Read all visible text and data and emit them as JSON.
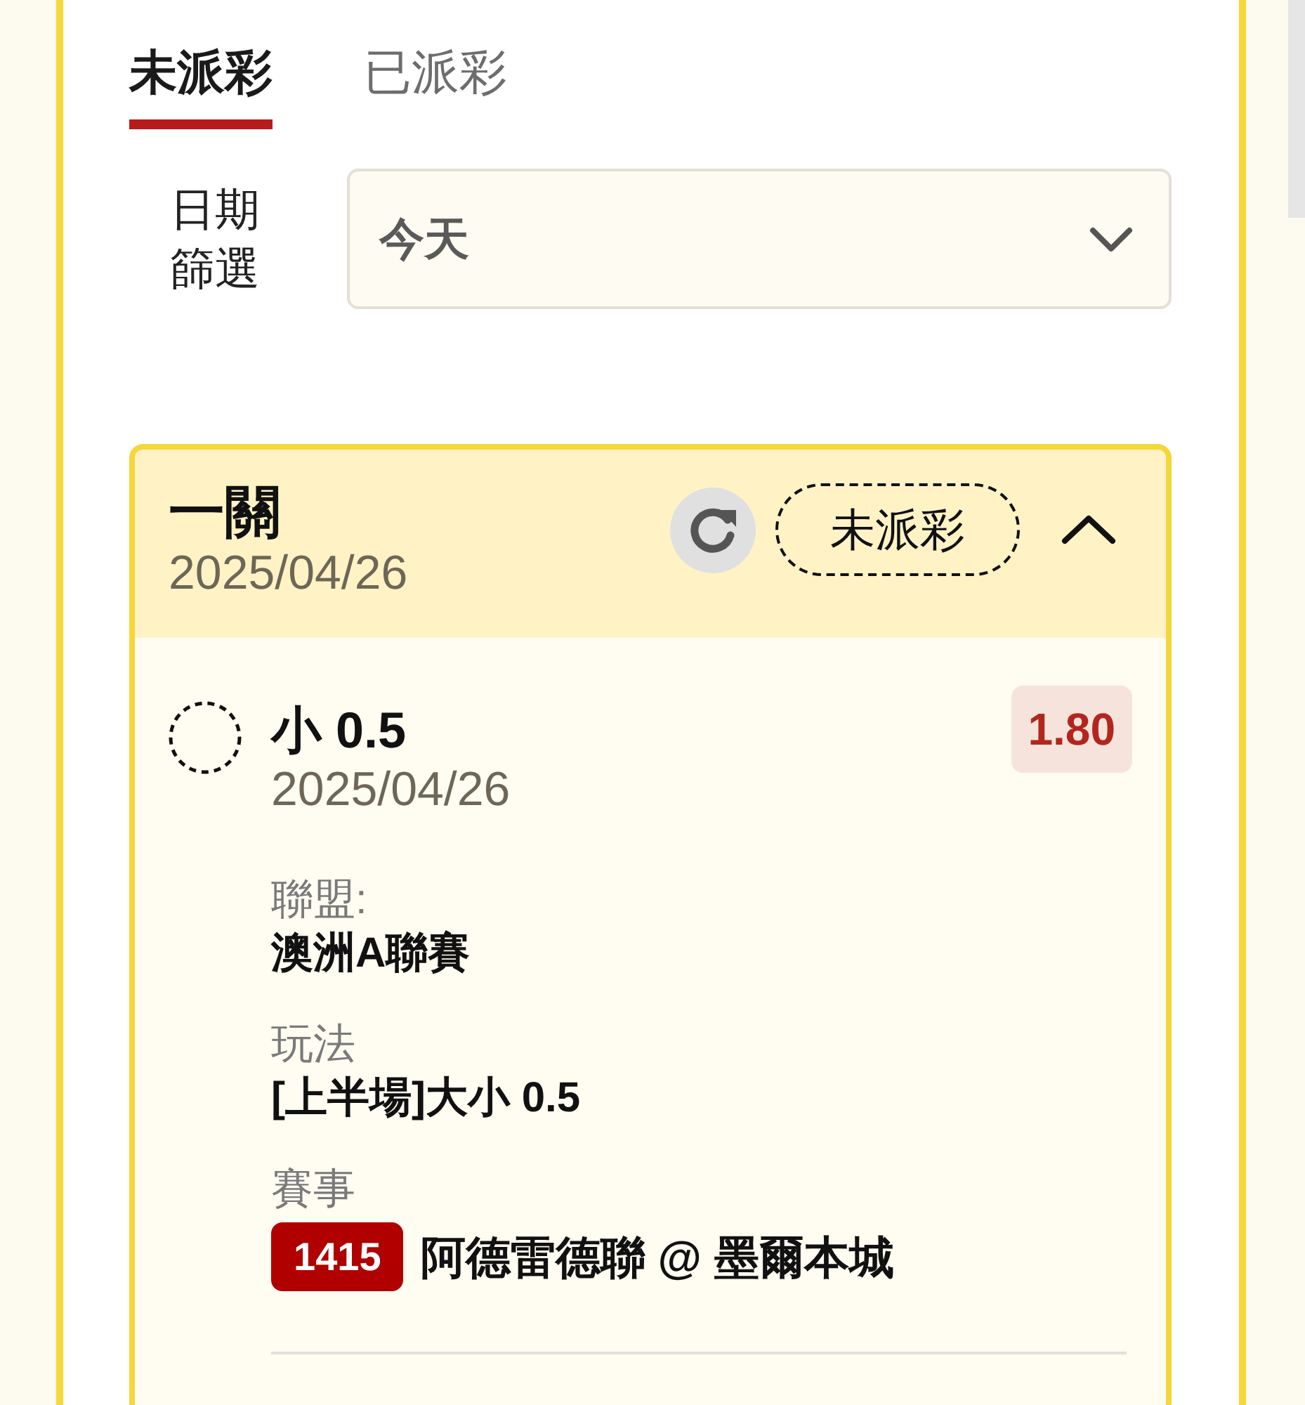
{
  "tabs": [
    {
      "label": "未派彩",
      "selected": true
    },
    {
      "label": "已派彩",
      "selected": false
    }
  ],
  "date_filter": {
    "label": "日期篩選",
    "value": "今天"
  },
  "bets": [
    {
      "title": "一關",
      "date": "2025/04/26",
      "status": "未派彩",
      "expanded": true,
      "selections": [
        {
          "selection": "小 0.5",
          "date": "2025/04/26",
          "odds": "1.80",
          "details": [
            {
              "kind": "text",
              "label": "聯盟:",
              "value": "澳洲A聯賽"
            },
            {
              "kind": "text",
              "label": "玩法",
              "value": "[上半場]大小 0.5"
            },
            {
              "kind": "match",
              "label": "賽事",
              "match_no": "1415",
              "value": "阿德雷德聯 @ 墨爾本城"
            }
          ]
        }
      ]
    }
  ]
}
